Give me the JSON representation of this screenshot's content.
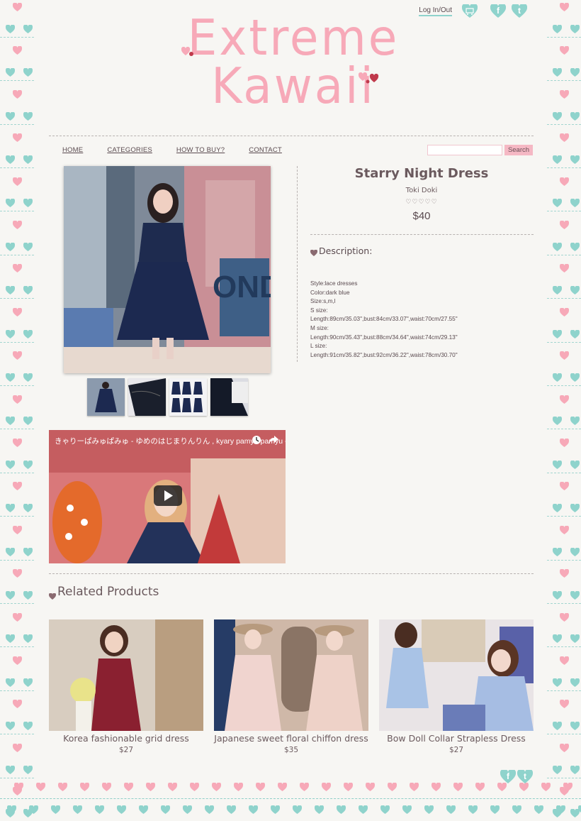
{
  "header": {
    "login_label": "Log In/Out",
    "cart_icon": "cart-icon",
    "social_icons": [
      "facebook-icon",
      "tumblr-icon"
    ],
    "facebook_letter": "f",
    "tumblr_letter": "t",
    "logo_line1": "Extreme",
    "logo_line2": "Kawaii"
  },
  "nav": {
    "items": [
      "HOME",
      "CATEGORIES",
      "HOW TO BUY?",
      "CONTACT"
    ]
  },
  "search": {
    "placeholder": "",
    "button_label": "Search"
  },
  "product": {
    "title": "Starry Night Dress",
    "brand": "Toki Doki",
    "rating_stars": "♡♡♡♡♡",
    "price": "$40",
    "description_heading": "Description:",
    "description_lines": [
      "Style:lace dresses",
      "Color:dark blue",
      "Size:s,m,l",
      "S size:",
      "Length:89cm/35.03\",bust:84cm/33.07\",waist:70cm/27.55\"",
      "M size:",
      "Length:90cm/35.43\",bust:88cm/34.64\",waist:74cm/29.13\"",
      "L size:",
      "Length:91cm/35.82\",bust:92cm/36.22\",waist:78cm/30.70\""
    ]
  },
  "video": {
    "title": "きゃりーぱみゅぱみゅ - ゆめのはじまりんりん , kyary pamyu pamyu - Yumeno H..."
  },
  "related": {
    "heading": "Related Products",
    "items": [
      {
        "name": "Korea fashionable grid dress",
        "price": "$27"
      },
      {
        "name": "Japanese sweet floral chiffon dress",
        "price": "$35"
      },
      {
        "name": "Bow Doll Collar Strapless Dress",
        "price": "$27"
      }
    ]
  },
  "colors": {
    "pink": "#f7a9b8",
    "teal": "#8fd3cc",
    "text": "#5a4a4f",
    "background": "#f7f6f3"
  }
}
